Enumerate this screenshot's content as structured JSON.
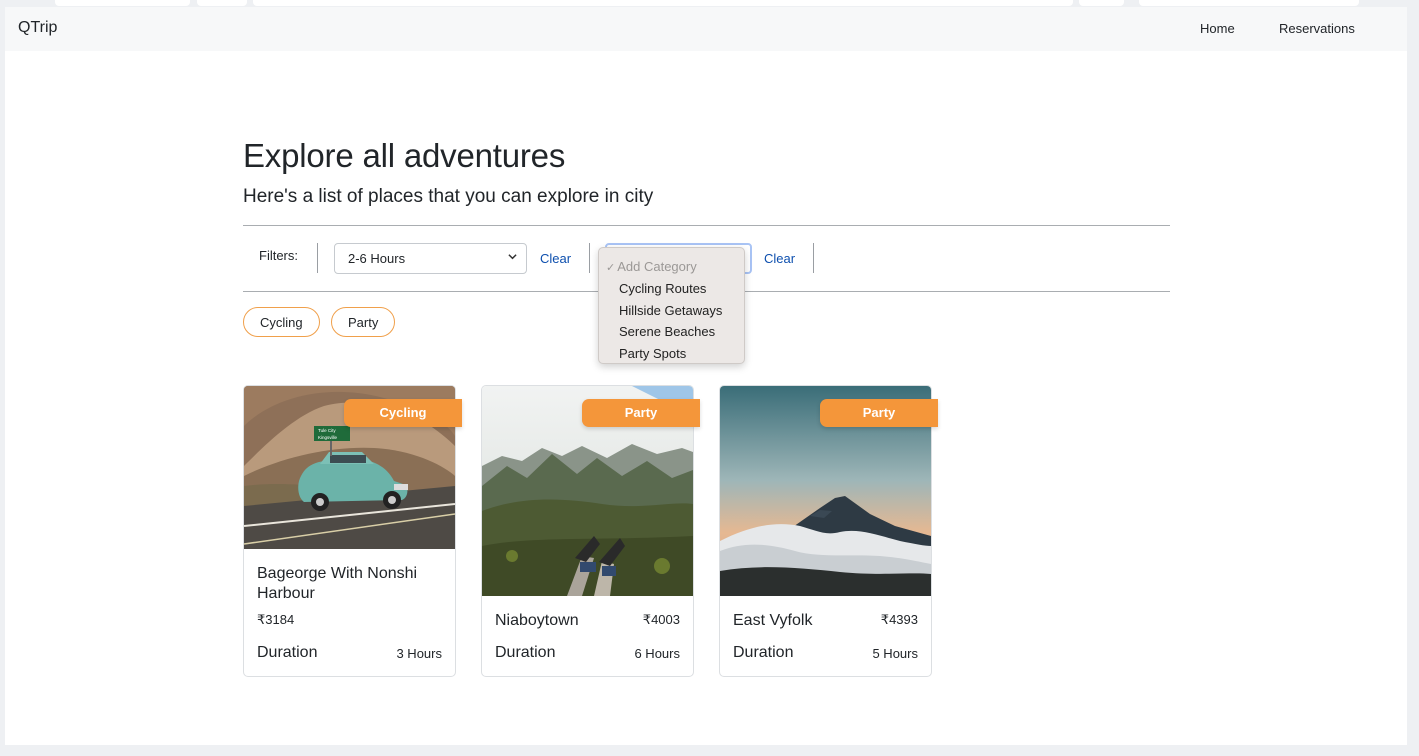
{
  "navbar": {
    "brand": "QTrip",
    "links": [
      "Home",
      "Reservations"
    ]
  },
  "page": {
    "title": "Explore all adventures",
    "subtitle": "Here's a list of places that you can explore in city"
  },
  "filters": {
    "label": "Filters:",
    "duration_select": {
      "value": "2-6 Hours"
    },
    "duration_clear": "Clear",
    "category_select": {
      "placeholder": "Add Category",
      "options": [
        "Cycling Routes",
        "Hillside Getaways",
        "Serene Beaches",
        "Party Spots"
      ]
    },
    "category_clear": "Clear",
    "chips": [
      "Cycling",
      "Party"
    ]
  },
  "adventures": [
    {
      "category": "Cycling",
      "name": "Bageorge With Nonshi Harbour",
      "price": "₹3184",
      "duration_label": "Duration",
      "duration": "3 Hours",
      "sign_text": [
        "Tule City",
        "Kingsville"
      ]
    },
    {
      "category": "Party",
      "name": "Niaboytown",
      "price": "₹4003",
      "duration_label": "Duration",
      "duration": "6 Hours"
    },
    {
      "category": "Party",
      "name": "East Vyfolk",
      "price": "₹4393",
      "duration_label": "Duration",
      "duration": "5 Hours"
    }
  ],
  "colors": {
    "accent": "#f4963a",
    "link": "#0d4fae",
    "chip_border": "#f0a04b"
  }
}
